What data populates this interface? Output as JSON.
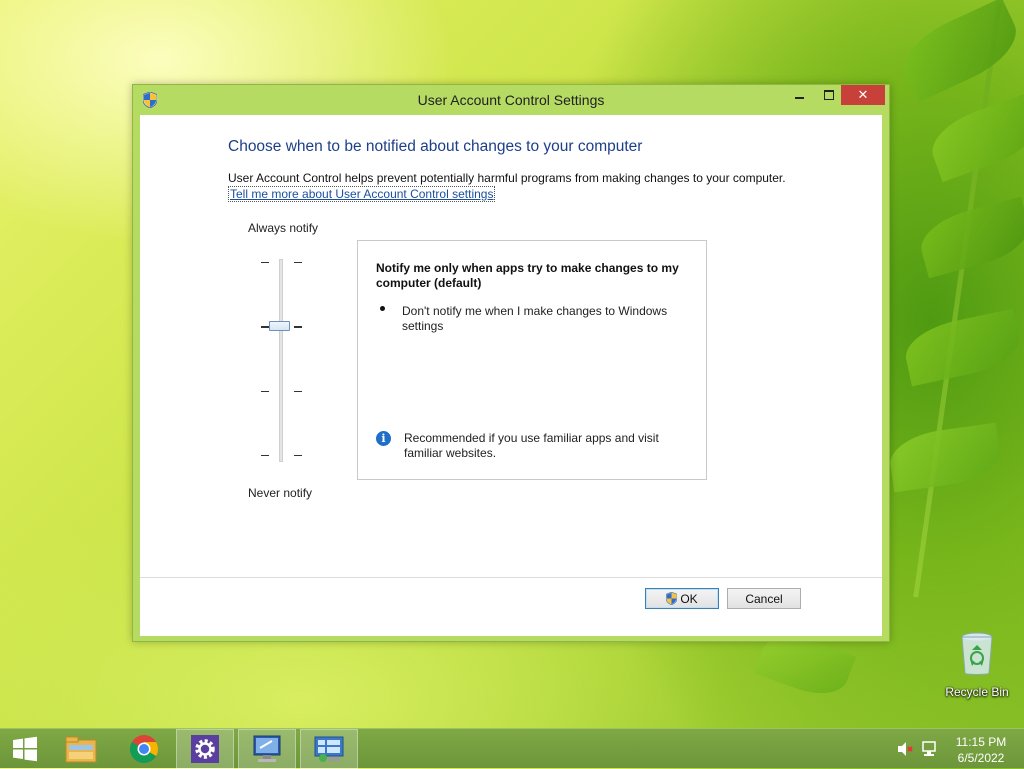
{
  "window": {
    "title": "User Account Control Settings",
    "close_label": "✕"
  },
  "content": {
    "heading": "Choose when to be notified about changes to your computer",
    "description": "User Account Control helps prevent potentially harmful programs from making changes to your computer.",
    "link": "Tell me more about User Account Control settings"
  },
  "slider": {
    "top_label": "Always notify",
    "bottom_label": "Never notify",
    "levels": 4,
    "selected_level": 3
  },
  "info": {
    "title": "Notify me only when apps try to make changes to my computer (default)",
    "bullet": "Don't notify me when I make changes to Windows settings",
    "recommendation": "Recommended if you use familiar apps and visit familiar websites.",
    "info_glyph": "i"
  },
  "buttons": {
    "ok": "OK",
    "cancel": "Cancel"
  },
  "desktop": {
    "recycle_bin": "Recycle Bin"
  },
  "taskbar": {
    "items": [
      "start",
      "file-explorer",
      "chrome",
      "settings",
      "remote-desktop",
      "control-panel"
    ],
    "active_item": "control-panel",
    "time": "11:15 PM",
    "date": "6/5/2022"
  },
  "colors": {
    "heading": "#1d3f8a",
    "link": "#1a4fa0",
    "close_button": "#c8403a",
    "window_frame": "#b5db63",
    "taskbar": "#739c3e"
  }
}
